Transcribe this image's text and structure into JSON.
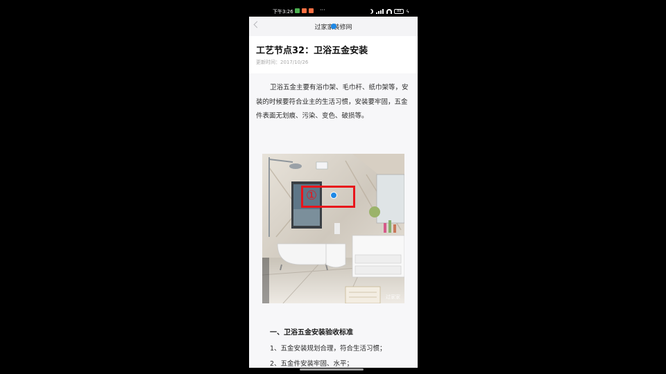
{
  "status_bar": {
    "time": "下午3:26",
    "more": "···",
    "battery": "88",
    "notif_colors": [
      "#4caf50",
      "#ff7043",
      "#ff7043"
    ]
  },
  "nav": {
    "title": "过家家装修网"
  },
  "article": {
    "title": "工艺节点32：卫浴五金安装",
    "updated": "更新时间：2017/10/26",
    "paragraph": "卫浴五金主要有浴巾架、毛巾杆、纸巾架等，安装的时候要符合业主的生活习惯，安装要牢固，五金件表面无划痕、污染、变色、破损等。",
    "photo_watermark": "过家家",
    "section_title": "一、卫浴五金安装验收标准",
    "list": [
      "1、五金安装规划合理，符合生活习惯；",
      "2、五金件安装牢固、水平；"
    ]
  },
  "overlay": {
    "label": "①",
    "color": "#e8151b",
    "dot_color": "#1e88e5"
  }
}
